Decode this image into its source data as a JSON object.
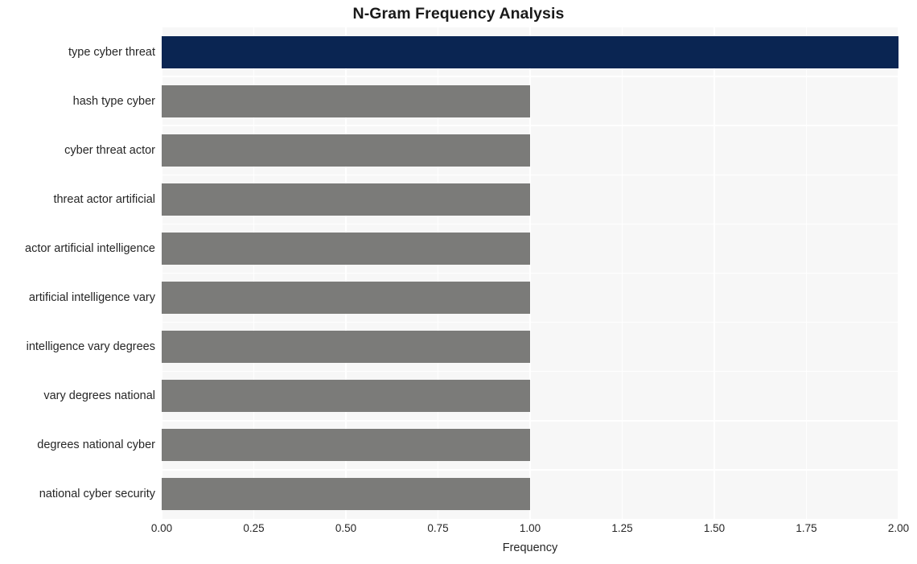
{
  "chart_data": {
    "type": "bar",
    "orientation": "horizontal",
    "title": "N-Gram Frequency Analysis",
    "xlabel": "Frequency",
    "ylabel": "",
    "categories": [
      "type cyber threat",
      "hash type cyber",
      "cyber threat actor",
      "threat actor artificial",
      "actor artificial intelligence",
      "artificial intelligence vary",
      "intelligence vary degrees",
      "vary degrees national",
      "degrees national cyber",
      "national cyber security"
    ],
    "values": [
      2,
      1,
      1,
      1,
      1,
      1,
      1,
      1,
      1,
      1
    ],
    "bar_colors": [
      "#0a2552",
      "#7b7b79",
      "#7b7b79",
      "#7b7b79",
      "#7b7b79",
      "#7b7b79",
      "#7b7b79",
      "#7b7b79",
      "#7b7b79",
      "#7b7b79"
    ],
    "xlim": [
      0,
      2
    ],
    "xticks": [
      0,
      0.25,
      0.5,
      0.75,
      1,
      1.25,
      1.5,
      1.75,
      2
    ],
    "xtick_labels": [
      "0.00",
      "0.25",
      "0.50",
      "0.75",
      "1.00",
      "1.25",
      "1.50",
      "1.75",
      "2.00"
    ],
    "grid": true,
    "grid_color": "#ffffff",
    "plot_background": "#f7f7f7",
    "figure_background": "#ffffff",
    "legend": null
  }
}
